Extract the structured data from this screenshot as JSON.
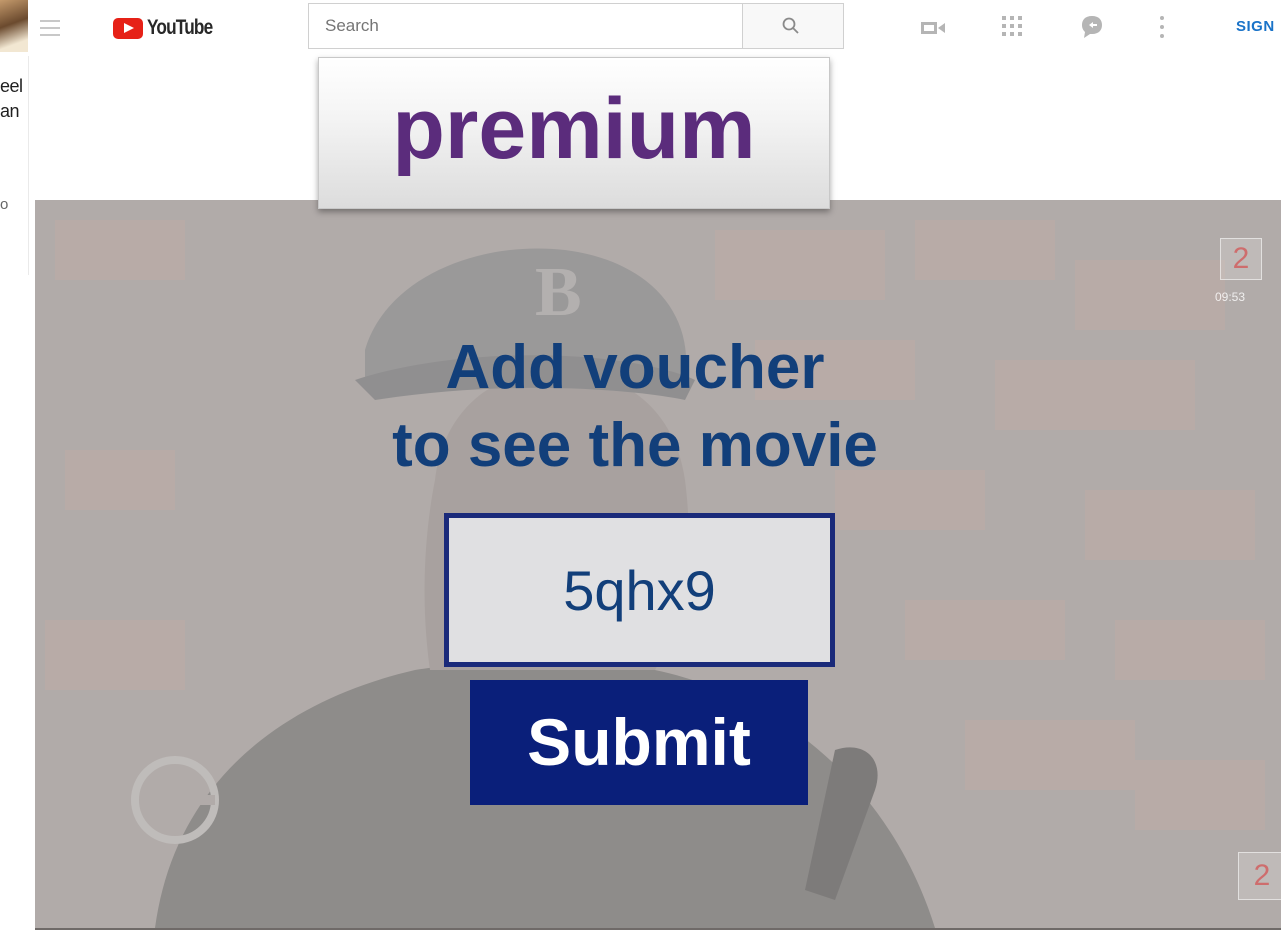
{
  "sidebar_peek": {
    "line1": "eel",
    "line2": "an",
    "line3": "o"
  },
  "topbar": {
    "logo_text": "YouTube",
    "search_placeholder": "Search",
    "sign_in_label": "SIGN"
  },
  "premium_badge": {
    "text": "premium",
    "color": "#5b2c7c"
  },
  "player": {
    "time": "09:53",
    "channel_badge": "2"
  },
  "voucher": {
    "heading_line1": "Add voucher",
    "heading_line2": "to see the movie",
    "code": "5qhx9",
    "submit_label": "Submit",
    "heading_color": "#123f7a",
    "button_color": "#0a1f7a"
  },
  "icons": {
    "menu": "hamburger-menu-icon",
    "search": "magnifier-icon",
    "video": "video-camera-icon",
    "apps": "grid-apps-icon",
    "chat": "chat-bubble-icon",
    "more": "vertical-dots-icon"
  }
}
